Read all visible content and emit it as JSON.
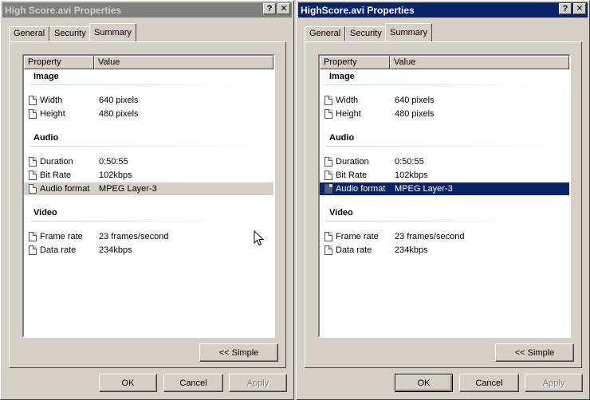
{
  "windows": [
    {
      "title": "High Score.avi Properties",
      "state": "inactive",
      "highlight": "grey"
    },
    {
      "title": "HighScore.avi Properties",
      "state": "active",
      "highlight": "blue"
    }
  ],
  "titlebar": {
    "help_glyph": "?",
    "close_glyph": "✕"
  },
  "tabs": [
    {
      "label": "General"
    },
    {
      "label": "Security"
    },
    {
      "label": "Summary"
    }
  ],
  "list": {
    "header_property": "Property",
    "header_value": "Value",
    "groups": [
      {
        "name": "Image",
        "rows": [
          {
            "property": "Width",
            "value": "640 pixels"
          },
          {
            "property": "Height",
            "value": "480 pixels"
          }
        ]
      },
      {
        "name": "Audio",
        "rows": [
          {
            "property": "Duration",
            "value": "0:50:55"
          },
          {
            "property": "Bit Rate",
            "value": "102kbps"
          },
          {
            "property": "Audio format",
            "value": "MPEG Layer-3"
          }
        ]
      },
      {
        "name": "Video",
        "rows": [
          {
            "property": "Frame rate",
            "value": "23 frames/second"
          },
          {
            "property": "Data rate",
            "value": "234kbps"
          }
        ]
      }
    ]
  },
  "buttons": {
    "simple": "<< Simple",
    "ok": "OK",
    "cancel": "Cancel",
    "apply": "Apply"
  },
  "colors": {
    "active_title": "#0a246a",
    "inactive_title": "#808080",
    "selection": "#0a246a",
    "face": "#d4d0c8"
  }
}
